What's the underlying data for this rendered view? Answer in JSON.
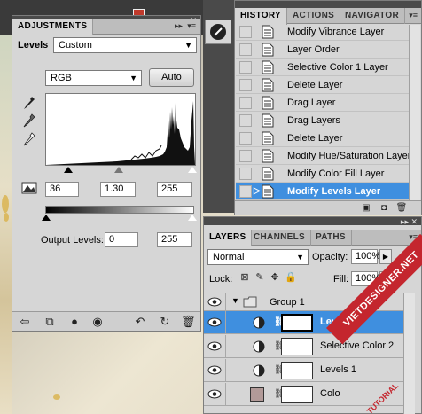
{
  "adjustments": {
    "tab_label": "ADJUSTMENTS",
    "section_label": "Levels",
    "preset_value": "Custom",
    "channel_value": "RGB",
    "auto_label": "Auto",
    "input_black": "36",
    "input_gamma": "1.30",
    "input_white": "255",
    "output_label": "Output Levels:",
    "output_black": "0",
    "output_white": "255"
  },
  "history": {
    "tabs": [
      "HISTORY",
      "ACTIONS",
      "NAVIGATOR"
    ],
    "items": [
      {
        "label": "Modify Vibrance Layer"
      },
      {
        "label": "Layer Order"
      },
      {
        "label": "Selective Color 1 Layer"
      },
      {
        "label": "Delete Layer"
      },
      {
        "label": "Drag Layer"
      },
      {
        "label": "Drag Layers"
      },
      {
        "label": "Delete Layer"
      },
      {
        "label": "Modify Hue/Saturation Layer"
      },
      {
        "label": "Modify Color Fill Layer"
      },
      {
        "label": "Modify Levels Layer",
        "selected": true
      }
    ]
  },
  "layers": {
    "tabs": [
      "LAYERS",
      "CHANNELS",
      "PATHS"
    ],
    "blend_mode": "Normal",
    "opacity_label": "Opacity:",
    "opacity_value": "100%",
    "lock_label": "Lock:",
    "fill_label": "Fill:",
    "fill_value": "100%",
    "group_name": "Group 1",
    "rows": [
      {
        "name": "Levels 2",
        "selected": true
      },
      {
        "name": "Selective Color 2"
      },
      {
        "name": "Levels 1"
      },
      {
        "name": "Colo"
      }
    ],
    "color_swatch": "#b29a98"
  },
  "watermark": {
    "line1": "VIETDESIGNER.NET",
    "line2": "TUTORIAL"
  },
  "colors": {
    "selection": "#3f8fdf",
    "panel": "#d6d6d6",
    "watermark": "#c4262e"
  }
}
